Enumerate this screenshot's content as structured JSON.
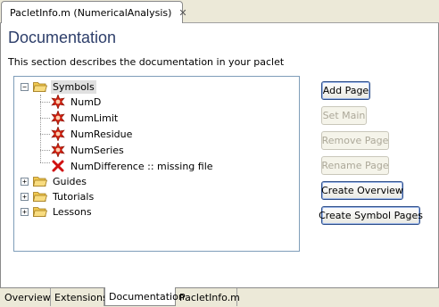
{
  "editor": {
    "tab_title": "PacletInfo.m (NumericalAnalysis)",
    "close_glyph": "✕"
  },
  "page": {
    "title": "Documentation",
    "description": "This section describes the documentation in your paclet"
  },
  "tree": {
    "expand_glyph": "+",
    "collapse_glyph": "−",
    "symbols_folder": "Symbols",
    "symbols": [
      "NumD",
      "NumLimit",
      "NumResidue",
      "NumSeries"
    ],
    "missing_item": "NumDifference :: missing file",
    "guides_folder": "Guides",
    "tutorials_folder": "Tutorials",
    "lessons_folder": "Lessons"
  },
  "buttons": {
    "add_page": "Add Page",
    "set_main": "Set Main",
    "remove_page": "Remove Page",
    "rename_page": "Rename Page",
    "create_overview": "Create Overview",
    "create_symbol_pages": "Create Symbol Pages"
  },
  "bottom_tabs": [
    "Overview",
    "Extensions",
    "Documentation",
    "PacletInfo.m"
  ],
  "colors": {
    "title": "#2d3e6a",
    "folder": "#f0c850",
    "star_icon": "#d02010",
    "error_icon": "#d01010"
  }
}
